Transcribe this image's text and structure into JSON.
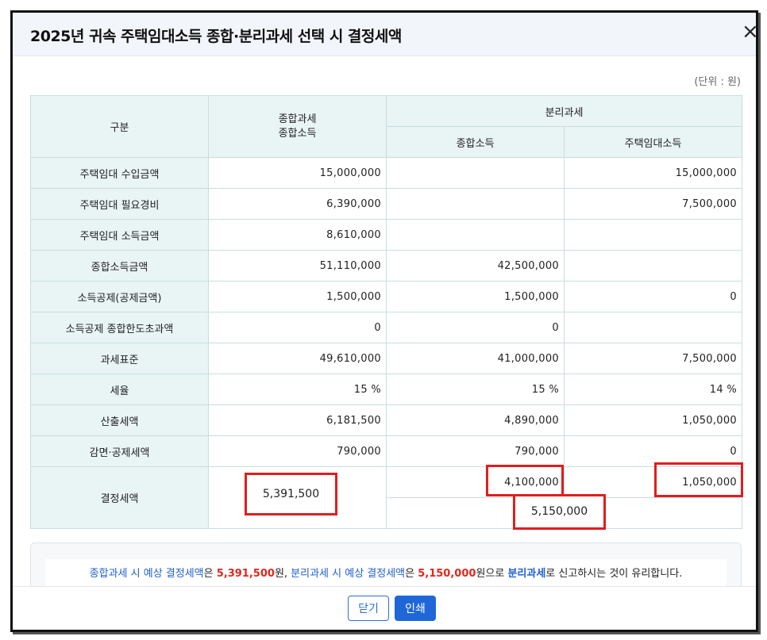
{
  "title": "2025년 귀속 주택임대소득 종합·분리과세 선택 시 결정세액",
  "close_glyph": "×",
  "unit": "(단위 : 원)",
  "table": {
    "col_label": "구분",
    "col_comprehensive_1": "종합과세",
    "col_comprehensive_2": "종합소득",
    "col_separate": "분리과세",
    "col_separate_comp": "종합소득",
    "col_separate_rental": "주택임대소득",
    "rows": [
      {
        "label": "주택임대 수입금액",
        "comp": "15,000,000",
        "sep_comp": "",
        "sep_rental": "15,000,000"
      },
      {
        "label": "주택임대 필요경비",
        "comp": "6,390,000",
        "sep_comp": "",
        "sep_rental": "7,500,000"
      },
      {
        "label": "주택임대 소득금액",
        "comp": "8,610,000",
        "sep_comp": "",
        "sep_rental": ""
      },
      {
        "label": "종합소득금액",
        "comp": "51,110,000",
        "sep_comp": "42,500,000",
        "sep_rental": ""
      },
      {
        "label": "소득공제(공제금액)",
        "comp": "1,500,000",
        "sep_comp": "1,500,000",
        "sep_rental": "0"
      },
      {
        "label": "소득공제 종합한도초과액",
        "comp": "0",
        "sep_comp": "0",
        "sep_rental": ""
      },
      {
        "label": "과세표준",
        "comp": "49,610,000",
        "sep_comp": "41,000,000",
        "sep_rental": "7,500,000"
      },
      {
        "label": "세율",
        "comp": "15 %",
        "sep_comp": "15 %",
        "sep_rental": "14 %"
      },
      {
        "label": "산출세액",
        "comp": "6,181,500",
        "sep_comp": "4,890,000",
        "sep_rental": "1,050,000"
      },
      {
        "label": "감면·공제세액",
        "comp": "790,000",
        "sep_comp": "790,000",
        "sep_rental": "0"
      }
    ],
    "final": {
      "label": "결정세액",
      "comp": "5,391,500",
      "sep_comp": "4,100,000",
      "sep_rental": "1,050,000",
      "sep_total": "5,150,000"
    }
  },
  "summary": {
    "part1": "종합과세 시 예상 결정세액",
    "part2": "은 ",
    "part3": "5,391,500",
    "part4": "원, ",
    "part5": "분리과세 시 예상 결정세액",
    "part6": "은 ",
    "part7": "5,150,000",
    "part8": "원으로 ",
    "part9": "분리과세",
    "part10": "로 신고하시는 것이 유리합니다."
  },
  "buttons": {
    "close": "닫기",
    "print": "인쇄"
  },
  "colors": {
    "highlight": "#e01e1e",
    "accent_blue": "#1f5fd1",
    "header_bg": "#e9f4f4"
  }
}
